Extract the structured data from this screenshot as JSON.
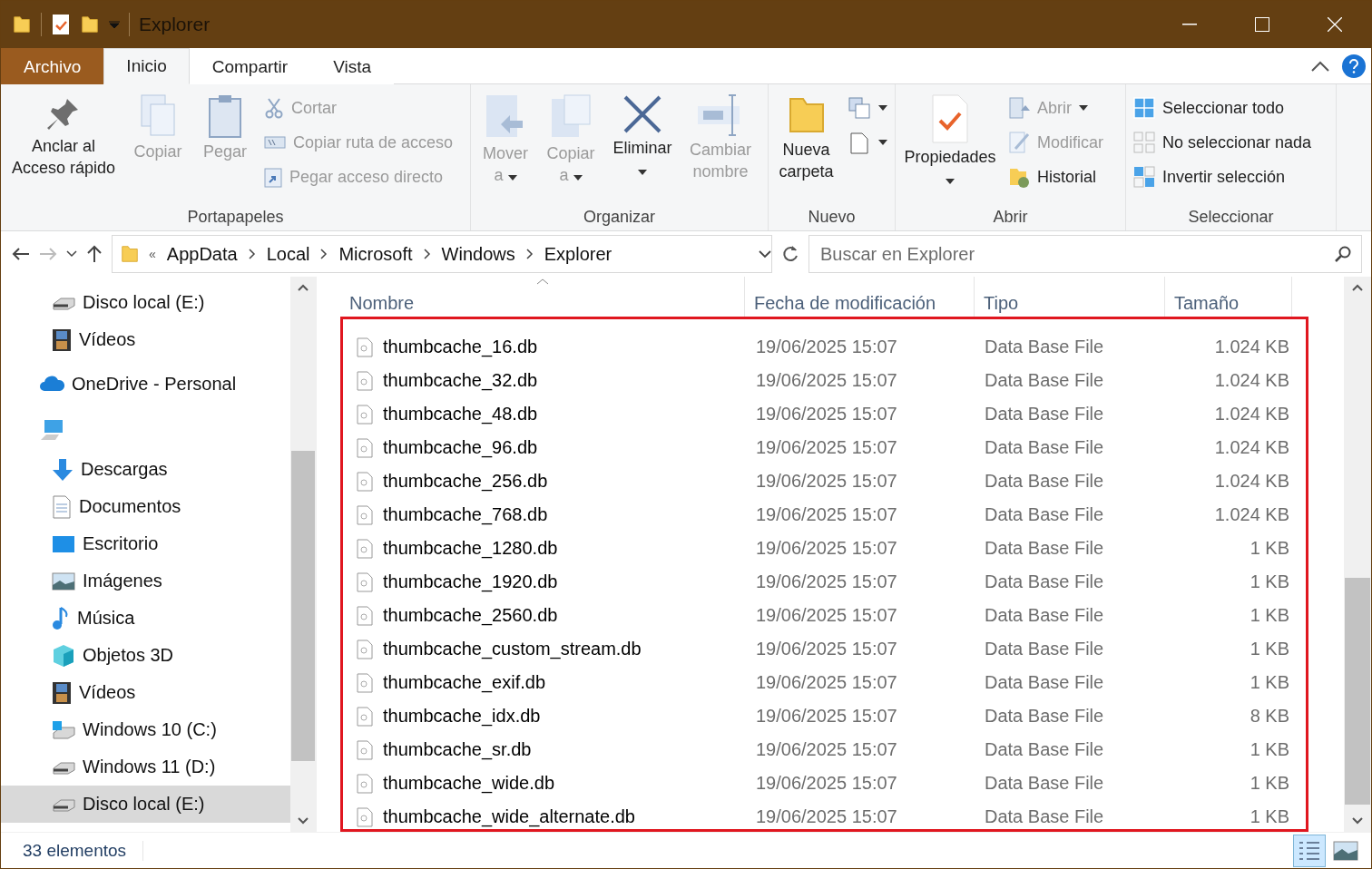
{
  "window": {
    "title": "Explorer"
  },
  "ribbon_tabs": [
    {
      "label": "Archivo",
      "kind": "file",
      "selected": false
    },
    {
      "label": "Inicio",
      "kind": "tab",
      "selected": true
    },
    {
      "label": "Compartir",
      "kind": "tab",
      "selected": false
    },
    {
      "label": "Vista",
      "kind": "tab",
      "selected": false
    }
  ],
  "ribbon_groups": [
    {
      "label": "Portapapeles",
      "items": [
        {
          "label": "Anclar al Acceso rápido",
          "kind": "large",
          "disabled": false,
          "dropdown": false
        },
        {
          "label": "Copiar",
          "kind": "large",
          "disabled": true,
          "dropdown": false
        },
        {
          "label": "Pegar",
          "kind": "large",
          "disabled": true,
          "dropdown": false
        },
        {
          "label": "Cortar",
          "kind": "small",
          "disabled": true,
          "dropdown": false
        },
        {
          "label": "Copiar ruta de acceso",
          "kind": "small",
          "disabled": true,
          "dropdown": false
        },
        {
          "label": "Pegar acceso directo",
          "kind": "small",
          "disabled": true,
          "dropdown": false
        }
      ]
    },
    {
      "label": "Organizar",
      "items": [
        {
          "label": "Mover a",
          "kind": "large",
          "disabled": true,
          "dropdown": true
        },
        {
          "label": "Copiar a",
          "kind": "large",
          "disabled": true,
          "dropdown": true
        },
        {
          "label": "Eliminar",
          "kind": "large",
          "disabled": false,
          "dropdown": true
        },
        {
          "label": "Cambiar nombre",
          "kind": "large",
          "disabled": true,
          "dropdown": false
        }
      ]
    },
    {
      "label": "Nuevo",
      "items": [
        {
          "label": "Nueva carpeta",
          "kind": "large",
          "disabled": false,
          "dropdown": false
        },
        {
          "kind": "icon",
          "disabled": false,
          "dropdown": true
        },
        {
          "kind": "icon",
          "disabled": false,
          "dropdown": true
        }
      ]
    },
    {
      "label": "Abrir",
      "items": [
        {
          "label": "Propiedades",
          "kind": "large",
          "disabled": false,
          "dropdown": true
        },
        {
          "label": "Abrir",
          "kind": "small",
          "disabled": true,
          "dropdown": true
        },
        {
          "label": "Modificar",
          "kind": "small",
          "disabled": true,
          "dropdown": false
        },
        {
          "label": "Historial",
          "kind": "small",
          "disabled": false,
          "dropdown": false
        }
      ]
    },
    {
      "label": "Seleccionar",
      "items": [
        {
          "label": "Seleccionar todo",
          "kind": "small",
          "disabled": false,
          "dropdown": false
        },
        {
          "label": "No seleccionar nada",
          "kind": "small",
          "disabled": false,
          "dropdown": false
        },
        {
          "label": "Invertir selección",
          "kind": "small",
          "disabled": false,
          "dropdown": false
        }
      ]
    }
  ],
  "address_bar": {
    "overflow": "«",
    "path": [
      "AppData",
      "Local",
      "Microsoft",
      "Windows",
      "Explorer"
    ]
  },
  "search": {
    "placeholder": "Buscar en Explorer"
  },
  "nav_pane": {
    "scrolled_items": [
      {
        "label": "Disco local (E:)",
        "kind": "drive",
        "selected": false
      },
      {
        "label": "Vídeos",
        "kind": "videos",
        "selected": false
      }
    ],
    "tree": [
      {
        "label": "OneDrive - Personal",
        "kind": "cloud",
        "selected": false
      },
      {
        "kind": "computer",
        "selected": false,
        "children": [
          {
            "label": "Descargas",
            "kind": "downloads",
            "selected": false
          },
          {
            "label": "Documentos",
            "kind": "documents",
            "selected": false
          },
          {
            "label": "Escritorio",
            "kind": "desktop",
            "selected": false
          },
          {
            "label": "Imágenes",
            "kind": "pictures",
            "selected": false
          },
          {
            "label": "Música",
            "kind": "music",
            "selected": false
          },
          {
            "label": "Objetos 3D",
            "kind": "objects",
            "selected": false
          },
          {
            "label": "Vídeos",
            "kind": "videos",
            "selected": false
          },
          {
            "label": "Windows 10 (C:)",
            "kind": "windrive",
            "selected": false
          },
          {
            "label": "Windows 11 (D:)",
            "kind": "drive",
            "selected": false
          },
          {
            "label": "Disco local (E:)",
            "kind": "drive",
            "selected": true
          }
        ]
      }
    ]
  },
  "table": {
    "columns": [
      {
        "label": "Nombre",
        "sorted": true
      },
      {
        "label": "Fecha de modificación",
        "sorted": false
      },
      {
        "label": "Tipo",
        "sorted": false
      },
      {
        "label": "Tamaño",
        "sorted": false
      }
    ],
    "rows": [
      [
        "thumbcache_16.db",
        "19/06/2025 15:07",
        "Data Base File",
        "1.024 KB"
      ],
      [
        "thumbcache_32.db",
        "19/06/2025 15:07",
        "Data Base File",
        "1.024 KB"
      ],
      [
        "thumbcache_48.db",
        "19/06/2025 15:07",
        "Data Base File",
        "1.024 KB"
      ],
      [
        "thumbcache_96.db",
        "19/06/2025 15:07",
        "Data Base File",
        "1.024 KB"
      ],
      [
        "thumbcache_256.db",
        "19/06/2025 15:07",
        "Data Base File",
        "1.024 KB"
      ],
      [
        "thumbcache_768.db",
        "19/06/2025 15:07",
        "Data Base File",
        "1.024 KB"
      ],
      [
        "thumbcache_1280.db",
        "19/06/2025 15:07",
        "Data Base File",
        "1 KB"
      ],
      [
        "thumbcache_1920.db",
        "19/06/2025 15:07",
        "Data Base File",
        "1 KB"
      ],
      [
        "thumbcache_2560.db",
        "19/06/2025 15:07",
        "Data Base File",
        "1 KB"
      ],
      [
        "thumbcache_custom_stream.db",
        "19/06/2025 15:07",
        "Data Base File",
        "1 KB"
      ],
      [
        "thumbcache_exif.db",
        "19/06/2025 15:07",
        "Data Base File",
        "1 KB"
      ],
      [
        "thumbcache_idx.db",
        "19/06/2025 15:07",
        "Data Base File",
        "8 KB"
      ],
      [
        "thumbcache_sr.db",
        "19/06/2025 15:07",
        "Data Base File",
        "1 KB"
      ],
      [
        "thumbcache_wide.db",
        "19/06/2025 15:07",
        "Data Base File",
        "1 KB"
      ],
      [
        "thumbcache_wide_alternate.db",
        "19/06/2025 15:07",
        "Data Base File",
        "1 KB"
      ]
    ]
  },
  "status_bar": {
    "count": "33 elementos",
    "views": [
      {
        "kind": "details",
        "selected": true
      },
      {
        "kind": "thumbnails",
        "selected": false
      }
    ]
  }
}
